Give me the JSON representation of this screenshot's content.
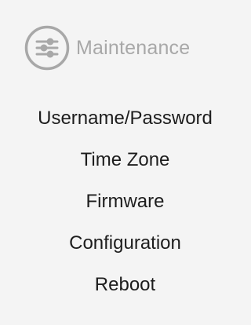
{
  "section": {
    "title": "Maintenance",
    "icon": "sliders-icon",
    "title_color": "#a8a8a8",
    "icon_color": "#a8a8a8"
  },
  "menu": {
    "items": [
      {
        "label": "Username/Password"
      },
      {
        "label": "Time Zone"
      },
      {
        "label": "Firmware"
      },
      {
        "label": "Configuration"
      },
      {
        "label": "Reboot"
      }
    ]
  },
  "colors": {
    "background": "#f4f4f4",
    "text": "#1d1d1d"
  }
}
